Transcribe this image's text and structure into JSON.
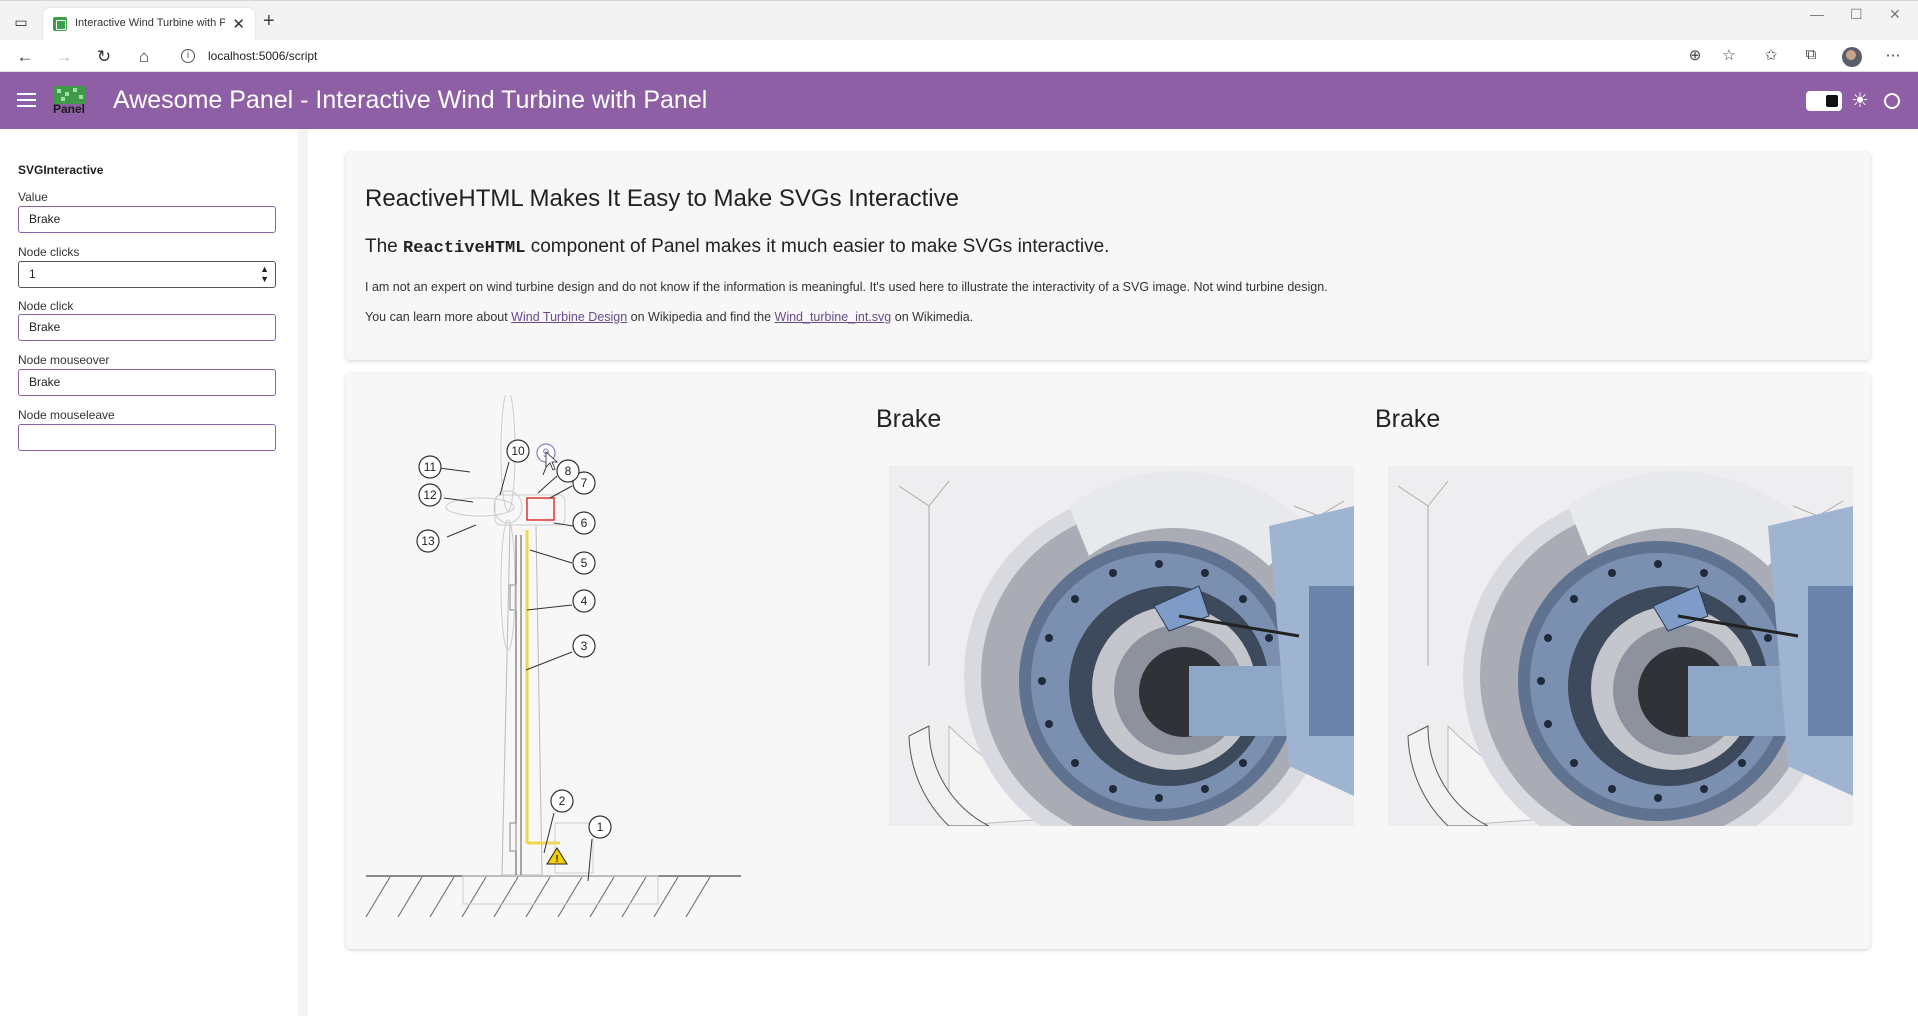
{
  "browser": {
    "tab_title": "Interactive Wind Turbine with Pa",
    "url": "localhost:5006/script"
  },
  "header": {
    "logo_text": "Panel",
    "title": "Awesome Panel  -  Interactive Wind Turbine with Panel",
    "accent_color": "#8f5fa5"
  },
  "sidebar": {
    "widget_title": "SVGInteractive",
    "fields": [
      {
        "label": "Value",
        "value": "Brake"
      },
      {
        "label": "Node clicks",
        "value": "1"
      },
      {
        "label": "Node click",
        "value": "Brake"
      },
      {
        "label": "Node mouseover",
        "value": "Brake"
      },
      {
        "label": "Node mouseleave",
        "value": ""
      }
    ]
  },
  "intro": {
    "heading": "ReactiveHTML Makes It Easy to Make SVGs Interactive",
    "subheading_pre": "The ",
    "subheading_code": "ReactiveHTML",
    "subheading_post": " component of Panel makes it much easier to make SVGs interactive.",
    "para1": "I am not an expert on wind turbine design and do not know if the information is meaningful. It's used here to illustrate the interactivity of a SVG image. Not wind turbine design.",
    "para2_pre": "You can learn more about ",
    "para2_link1": "Wind Turbine Design",
    "para2_mid": " on Wikipedia and find the ",
    "para2_link2": "Wind_turbine_int.svg",
    "para2_post": " on Wikimedia."
  },
  "diagram": {
    "labels": [
      "1",
      "2",
      "3",
      "4",
      "5",
      "6",
      "7",
      "8",
      "9",
      "10",
      "11",
      "12",
      "13"
    ]
  },
  "panels": [
    {
      "title": "Brake"
    },
    {
      "title": "Brake"
    }
  ]
}
